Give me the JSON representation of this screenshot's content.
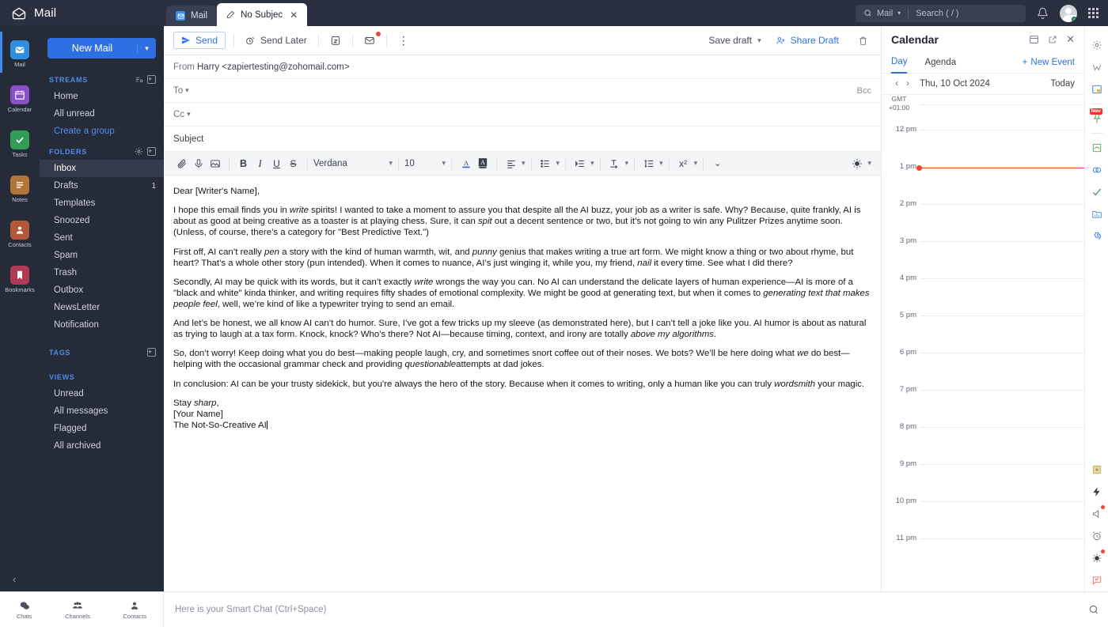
{
  "topbar": {
    "brand": "Mail",
    "brand_icon": "envelope-open-icon",
    "tabs": [
      {
        "label": "Mail",
        "icon": "mail-square-icon",
        "active": false,
        "closable": false
      },
      {
        "label": "No Subjec",
        "icon": "pencil-icon",
        "active": true,
        "closable": true
      }
    ],
    "search": {
      "scope": "Mail",
      "placeholder": "Search ( / )"
    },
    "bell_icon": "bell-icon",
    "avatar": "user-avatar",
    "apps_icon": "app-grid-icon"
  },
  "rail": {
    "items": [
      {
        "label": "Mail",
        "icon": "mail-app-icon",
        "color": "#2f8fe0",
        "active": true
      },
      {
        "label": "Calendar",
        "icon": "calendar-app-icon",
        "color": "#8b4fc9",
        "active": false
      },
      {
        "label": "Tasks",
        "icon": "tasks-app-icon",
        "color": "#2f9e56",
        "active": false
      },
      {
        "label": "Notes",
        "icon": "notes-app-icon",
        "color": "#b3743a",
        "active": false
      },
      {
        "label": "Contacts",
        "icon": "contacts-app-icon",
        "color": "#b3593a",
        "active": false
      },
      {
        "label": "Bookmarks",
        "icon": "bookmarks-app-icon",
        "color": "#b03a55",
        "active": false
      }
    ],
    "collapse_icon": "chevron-left-icon"
  },
  "folders": {
    "new_mail": "New Mail",
    "sections": [
      {
        "title": "STREAMS",
        "has_settings_icon": true,
        "has_add_icon": true,
        "items": [
          {
            "label": "Home",
            "count": "",
            "selected": false,
            "link": false
          },
          {
            "label": "All unread",
            "count": "",
            "selected": false,
            "link": false
          },
          {
            "label": "Create a group",
            "count": "",
            "selected": false,
            "link": true
          }
        ]
      },
      {
        "title": "FOLDERS",
        "has_settings_icon": true,
        "has_add_icon": true,
        "items": [
          {
            "label": "Inbox",
            "count": "",
            "selected": true,
            "link": false
          },
          {
            "label": "Drafts",
            "count": "1",
            "selected": false,
            "link": false
          },
          {
            "label": "Templates",
            "count": "",
            "selected": false,
            "link": false
          },
          {
            "label": "Snoozed",
            "count": "",
            "selected": false,
            "link": false
          },
          {
            "label": "Sent",
            "count": "",
            "selected": false,
            "link": false
          },
          {
            "label": "Spam",
            "count": "",
            "selected": false,
            "link": false
          },
          {
            "label": "Trash",
            "count": "",
            "selected": false,
            "link": false
          },
          {
            "label": "Outbox",
            "count": "",
            "selected": false,
            "link": false
          },
          {
            "label": "NewsLetter",
            "count": "",
            "selected": false,
            "link": false
          },
          {
            "label": "Notification",
            "count": "",
            "selected": false,
            "link": false
          }
        ]
      },
      {
        "title": "TAGS",
        "has_settings_icon": false,
        "has_add_icon": true,
        "items": []
      },
      {
        "title": "VIEWS",
        "has_settings_icon": false,
        "has_add_icon": false,
        "items": [
          {
            "label": "Unread",
            "count": "",
            "selected": false,
            "link": false
          },
          {
            "label": "All messages",
            "count": "",
            "selected": false,
            "link": false
          },
          {
            "label": "Flagged",
            "count": "",
            "selected": false,
            "link": false
          },
          {
            "label": "All archived",
            "count": "",
            "selected": false,
            "link": false
          }
        ]
      }
    ]
  },
  "compose": {
    "toolbar": {
      "send": "Send",
      "send_later": "Send Later",
      "snooze_icon": "clock-icon",
      "mail_badge_icon": "mail-alert-icon",
      "more_icon": "kebab-menu-icon",
      "save_draft": "Save draft",
      "share_draft": "Share Draft",
      "delete_icon": "trash-icon"
    },
    "fields": {
      "from_label": "From",
      "from_value": "Harry <zapiertesting@zohomail.com>",
      "to_label": "To",
      "to_value": "",
      "bcc_label": "Bcc",
      "cc_label": "Cc",
      "cc_value": "",
      "subject_placeholder": "Subject",
      "subject_value": ""
    },
    "format": {
      "attach_icon": "paperclip-icon",
      "mic_icon": "microphone-icon",
      "image_icon": "insert-image-icon",
      "bold": "B",
      "italic": "I",
      "underline": "U",
      "strike": "S",
      "font_family": "Verdana",
      "font_size": "10",
      "text_color_icon": "text-color-icon",
      "highlight_icon": "highlight-color-icon",
      "align_icon": "align-left-icon",
      "list_icon": "bulleted-list-icon",
      "indent_icon": "indent-icon",
      "line_icon": "text-direction-icon",
      "spacing_icon": "line-spacing-icon",
      "superscript": "x²",
      "more_icon": "chevron-double-down-icon",
      "theme_icon": "brightness-icon"
    },
    "body": {
      "greeting": "Dear [Writer's Name],",
      "p1_a": "I hope this email finds you in ",
      "p1_i1": "write",
      "p1_b": " spirits! I wanted to take a moment to assure you that despite all the AI buzz, your job as a writer is safe. Why? Because, quite frankly, AI is about as good at being creative as a toaster is at playing chess. Sure, it can ",
      "p1_i2": "spit",
      "p1_c": " out a decent sentence or two, but it’s not going to win any Pulitzer Prizes anytime soon. (Unless, of course, there’s a category for \"Best Predictive Text.\")",
      "p2_a": "First off, AI can’t really ",
      "p2_i1": "pen",
      "p2_b": " a story with the kind of human warmth, wit, and ",
      "p2_i2": "punny",
      "p2_c": " genius that makes writing a true art form. We might know a thing or two about rhyme, but heart? That’s a whole other story (pun intended). When it comes to nuance, AI’s just winging it, while you, my friend, ",
      "p2_i3": "nail",
      "p2_d": " it every time. See what I did there?",
      "p3_a": "Secondly, AI may be quick with its words, but it can’t exactly ",
      "p3_i1": "write",
      "p3_b": " wrongs the way you can. No AI can understand the delicate layers of human experience—AI is more of a \"black and white\" kinda thinker, and writing requires fifty shades of emotional complexity. We might be good at generating text, but when it comes to ",
      "p3_i2": "generating text that makes people feel",
      "p3_c": ", well, we’re kind of like a typewriter trying to send an email.",
      "p4_a": "And let’s be honest, we all know AI can’t do humor. Sure, I’ve got a few tricks up my sleeve (as demonstrated here), but I can’t tell a joke like you. AI humor is about as natural as trying to laugh at a tax form. Knock, knock? Who’s there? Not AI—because timing, context, and irony are totally ",
      "p4_i1": "above my algorithms",
      "p4_b": ".",
      "p5_a": "So, don’t worry! Keep doing what you do best—making people laugh, cry, and sometimes snort coffee out of their noses. We bots? We’ll be here doing what ",
      "p5_i1": "we",
      "p5_b": " do best—helping with the occasional grammar check and providing ",
      "p5_i2": "questionable",
      "p5_c": "attempts at dad jokes.",
      "p6_a": "In conclusion: AI can be your trusty sidekick, but you're always the hero of the story. Because when it comes to writing, only a human like you can truly ",
      "p6_i1": "wordsmith",
      "p6_b": " your magic.",
      "sig_a": "Stay ",
      "sig_i": "sharp",
      "sig_b": ",",
      "sig_name": "[Your Name]",
      "sig_title": "The Not-So-Creative AI"
    }
  },
  "calendar": {
    "title": "Calendar",
    "calendar_icon": "calendar-icon",
    "popout_icon": "external-link-icon",
    "close_icon": "close-icon",
    "tabs": [
      {
        "label": "Day",
        "active": true
      },
      {
        "label": "Agenda",
        "active": false
      }
    ],
    "new_event": "New Event",
    "prev_icon": "chevron-left-icon",
    "next_icon": "chevron-right-icon",
    "date": "Thu, 10 Oct 2024",
    "today": "Today",
    "timezone_line1": "GMT",
    "timezone_line2": "+01:00",
    "hours": [
      "12 pm",
      "1 pm",
      "2 pm",
      "3 pm",
      "4 pm",
      "5 pm",
      "6 pm",
      "7 pm",
      "8 pm",
      "9 pm",
      "10 pm",
      "11 pm"
    ],
    "now_marker_hour": "1 pm",
    "now_color": "#f5442e"
  },
  "right_rail": {
    "top_items": [
      {
        "icon": "gear-icon",
        "badge": "",
        "dot": false
      },
      {
        "icon": "zoho-v-icon",
        "badge": "",
        "dot": false
      },
      {
        "icon": "note-window-icon",
        "badge": "",
        "dot": false
      }
    ],
    "mid_items": [
      {
        "icon": "pin-new-icon",
        "badge": "New",
        "dot": false
      },
      {
        "icon": "signature-icon",
        "badge": "",
        "dot": false
      },
      {
        "icon": "link-icon",
        "badge": "",
        "dot": false
      },
      {
        "icon": "check-mark-icon",
        "badge": "",
        "dot": false
      },
      {
        "icon": "folder-chart-icon",
        "badge": "",
        "dot": false
      },
      {
        "icon": "puzzle-icon",
        "badge": "",
        "dot": false
      }
    ],
    "bottom_items": [
      {
        "icon": "add-note-icon",
        "badge": "",
        "dot": false
      },
      {
        "icon": "lightning-icon",
        "badge": "",
        "dot": false
      },
      {
        "icon": "megaphone-icon",
        "badge": "",
        "dot": true
      },
      {
        "icon": "alarm-clock-icon",
        "badge": "",
        "dot": false
      },
      {
        "icon": "brightness-icon",
        "badge": "",
        "dot": true
      },
      {
        "icon": "chat-bubble-icon",
        "badge": "",
        "dot": false
      }
    ]
  },
  "bottom_bar": {
    "chat_items": [
      {
        "label": "Chats",
        "icon": "chat-icon"
      },
      {
        "label": "Channels",
        "icon": "channels-icon"
      },
      {
        "label": "Contacts",
        "icon": "contacts-icon"
      }
    ],
    "smart_chat_placeholder": "Here is your Smart Chat (Ctrl+Space)",
    "search_icon": "search-icon"
  }
}
